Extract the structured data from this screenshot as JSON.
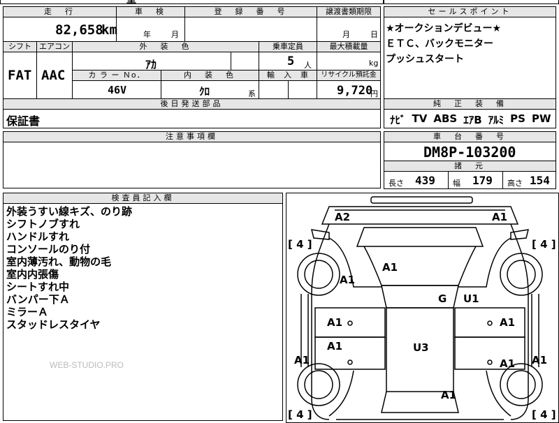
{
  "top_partial": {
    "left": "型",
    "mid": "車台等",
    "right": "年"
  },
  "row1": {
    "mileage_header": "走　行",
    "mileage_value": "82,658",
    "mileage_unit": "km",
    "inspection_header": "車　検",
    "inspection_year": "年",
    "inspection_month": "月",
    "reg_header": "登　録　番　号",
    "transfer_header": "譲渡書類期限",
    "transfer_month": "月",
    "transfer_day": "日"
  },
  "row2": {
    "shift_header": "シフト",
    "ac_header": "エアコン",
    "shift_value": "FAT",
    "ac_value": "AAC",
    "exterior_color_header": "外　装　色",
    "exterior_color_value": "ｱｶ",
    "capacity_header": "乗車定員",
    "capacity_value": "5",
    "capacity_unit": "人",
    "max_load_header": "最大積載量",
    "max_load_unit": "kg",
    "color_no_header": "カ ラ ー Ｎo．",
    "color_no_value": "46V",
    "interior_color_header": "内　装　色",
    "interior_color_value": "ｸﾛ",
    "interior_color_suffix": "系",
    "import_header": "輸　入　車",
    "recycle_header": "リサイクル預託金",
    "recycle_value": "9,720",
    "recycle_unit": "円"
  },
  "later_parts": {
    "header": "後日発送部品",
    "value": "保証書"
  },
  "caution": {
    "header": "注意事項欄"
  },
  "inspector": {
    "header": "検査員記入欄",
    "notes": [
      "外装うすい線キズ、のり跡",
      "シフトノブすれ",
      "ハンドルすれ",
      "コンソールのり付",
      "室内薄汚れ、動物の毛",
      "室内内張傷",
      "シートすれ中",
      "バンパー下Ａ",
      "ミラーＡ",
      "スタッドレスタイヤ"
    ],
    "watermark": "WEB-STUDIO.PRO"
  },
  "sales_point": {
    "header": "セールスポイント",
    "lines": [
      "★オークションデビュー★",
      "ＥＴＣ、バックモニター",
      "プッシュスタート"
    ]
  },
  "equipment": {
    "header": "純　正　装　備",
    "items": [
      "ﾅﾋﾞ",
      "TV",
      "ABS",
      "ｴｱB",
      "ｱﾙﾐ",
      "PS",
      "PW"
    ]
  },
  "chassis": {
    "header": "車　台　番　号",
    "value": "DM8P-103200"
  },
  "specs": {
    "header": "諸　元",
    "length_label": "長さ",
    "length_value": "439",
    "width_label": "幅",
    "width_value": "179",
    "height_label": "高さ",
    "height_value": "154"
  },
  "diagram": {
    "marks": {
      "front_left": "A2",
      "front_right": "A1",
      "hood": "A1",
      "left_front_fender": "A1",
      "left_front_door": "A1",
      "left_rear_door": "A1",
      "left_rear_quarter": "A1",
      "right_front_door": "A1",
      "right_rear_door": "A1",
      "right_rear_quarter": "A1",
      "roof_g": "G",
      "roof_u1": "U1",
      "roof_u3": "U3",
      "rear": "A1"
    },
    "tread": {
      "fl": "[ 4 ]",
      "fr": "[ 4 ]",
      "rl": "[ 4 ]",
      "rr": "[ 4 ]"
    }
  }
}
